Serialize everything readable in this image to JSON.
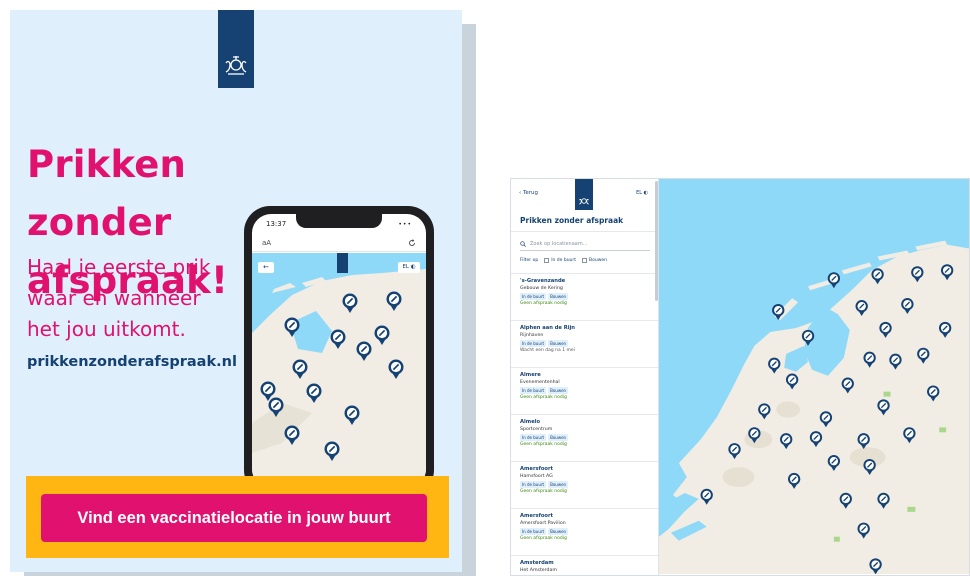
{
  "poster": {
    "headline_line1": "Prikken zonder",
    "headline_line2": "afspraak!",
    "sub_line1": "Haal je eerste prik",
    "sub_line2": "waar en wanneer",
    "sub_line3": "het jou uitkomt.",
    "url": "prikkenzonderafspraak.nl",
    "cta": "Vind een vaccinatielocatie in jouw buurt",
    "colors": {
      "background": "#dfeffc",
      "accent": "#e1116f",
      "brand": "#154273",
      "cta_bar": "#ffb612",
      "sea": "#8ed8f8",
      "land": "#f1ede4"
    }
  },
  "phone": {
    "time": "13:37",
    "status_right": "••• ",
    "address_text": "aA",
    "reload_icon": "reload-icon",
    "back_label": "←",
    "lang_label": "EL ◐"
  },
  "webapp": {
    "back_label": "Terug",
    "lang_label": "EL",
    "title": "Prikken zonder afspraak",
    "search_placeholder": "Zoek op locatienaam...",
    "filters": [
      "Filter op",
      "In de buurt",
      "Bouwen"
    ],
    "locations": [
      {
        "city": "'s-Gravenzande",
        "name": "Gebouw de Kering",
        "tags": [
          "In de buurt",
          "Bouwen"
        ],
        "status": "Geen afspraak nodig",
        "status_style": "ok"
      },
      {
        "city": "Alphen aan de Rijn",
        "name": "Rijnhaven",
        "tags": [
          "In de buurt",
          "Bouwen"
        ],
        "status": "Wacht een dag na 1 mei",
        "status_style": "alt"
      },
      {
        "city": "Almere",
        "name": "Evenementenhal",
        "tags": [
          "In de buurt",
          "Bouwen"
        ],
        "status": "Geen afspraak nodig",
        "status_style": "ok"
      },
      {
        "city": "Almelo",
        "name": "Sportcentrum",
        "tags": [
          "In de buurt",
          "Bouwen"
        ],
        "status": "Geen afspraak nodig",
        "status_style": "ok"
      },
      {
        "city": "Amersfoort",
        "name": "Hamsfoort AG",
        "tags": [
          "In de buurt",
          "Bouwen"
        ],
        "status": "Geen afspraak nodig",
        "status_style": "ok"
      },
      {
        "city": "Amersfoort",
        "name": "Amersfoort Pavilion",
        "tags": [
          "In de buurt",
          "Bouwen"
        ],
        "status": "Geen afspraak nodig",
        "status_style": "ok"
      },
      {
        "city": "Amsterdam",
        "name": "Het Amsterdam",
        "tags": [],
        "status": "",
        "status_style": "ok"
      }
    ]
  }
}
